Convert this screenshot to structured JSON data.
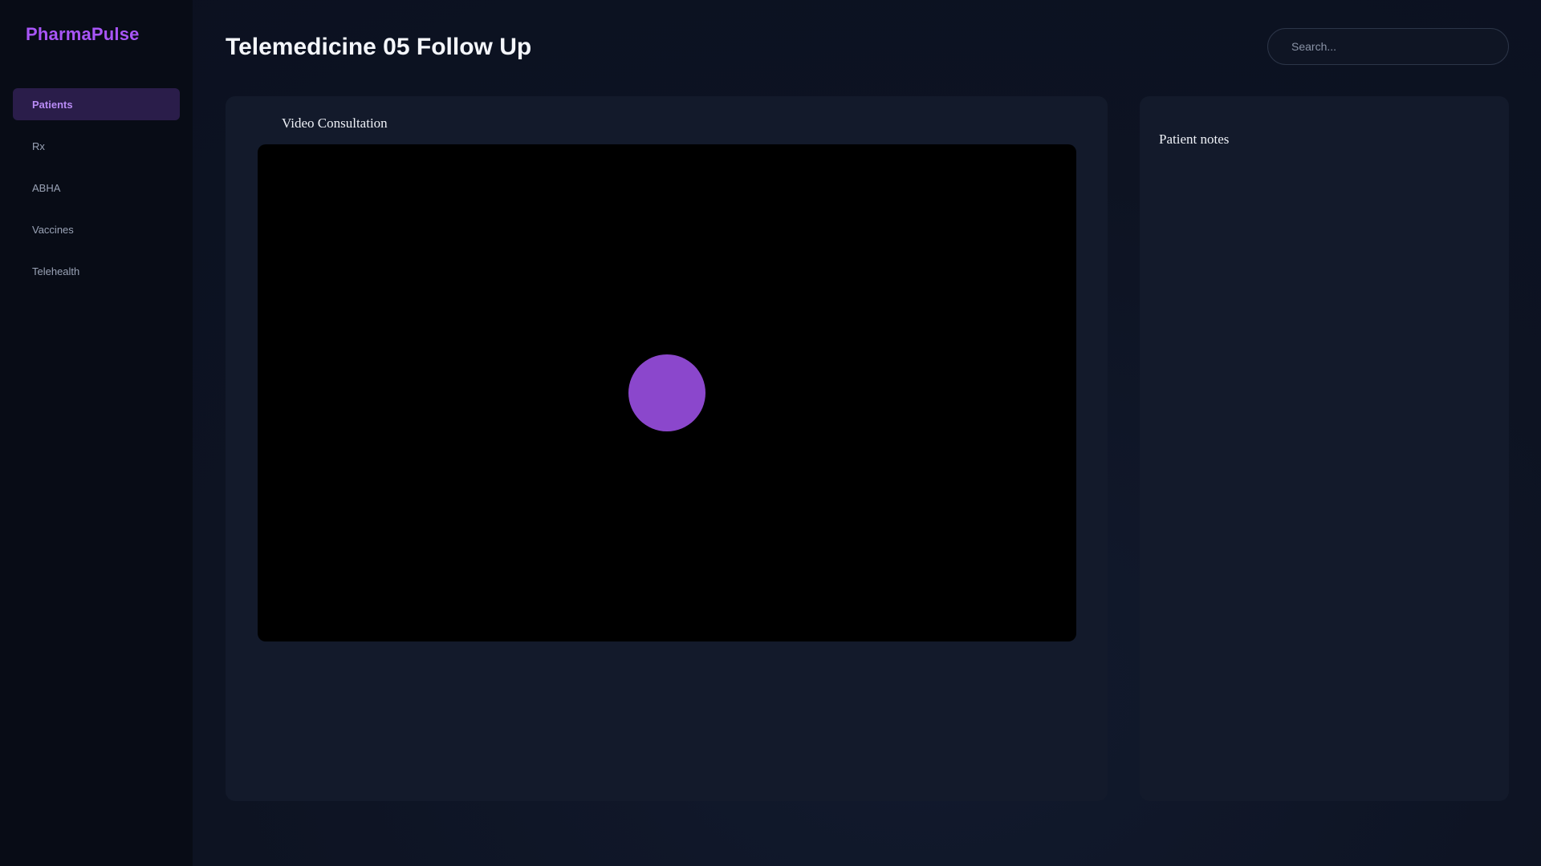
{
  "app": {
    "brand": "PharmaPulse"
  },
  "sidebar": {
    "items": [
      {
        "label": "Patients",
        "active": true
      },
      {
        "label": "Rx",
        "active": false
      },
      {
        "label": "ABHA",
        "active": false
      },
      {
        "label": "Vaccines",
        "active": false
      },
      {
        "label": "Telehealth",
        "active": false
      }
    ]
  },
  "header": {
    "title": "Telemedicine 05 Follow Up",
    "search": {
      "placeholder": "Search...",
      "value": ""
    }
  },
  "video": {
    "title": "Video Consultation",
    "avatar_color": "#8b47cc"
  },
  "notes": {
    "title": "Patient notes"
  },
  "colors": {
    "accent": "#a855f7",
    "active_bg": "#2a1d4a",
    "panel_bg": "#131a2b",
    "sidebar_bg": "#080c16"
  }
}
